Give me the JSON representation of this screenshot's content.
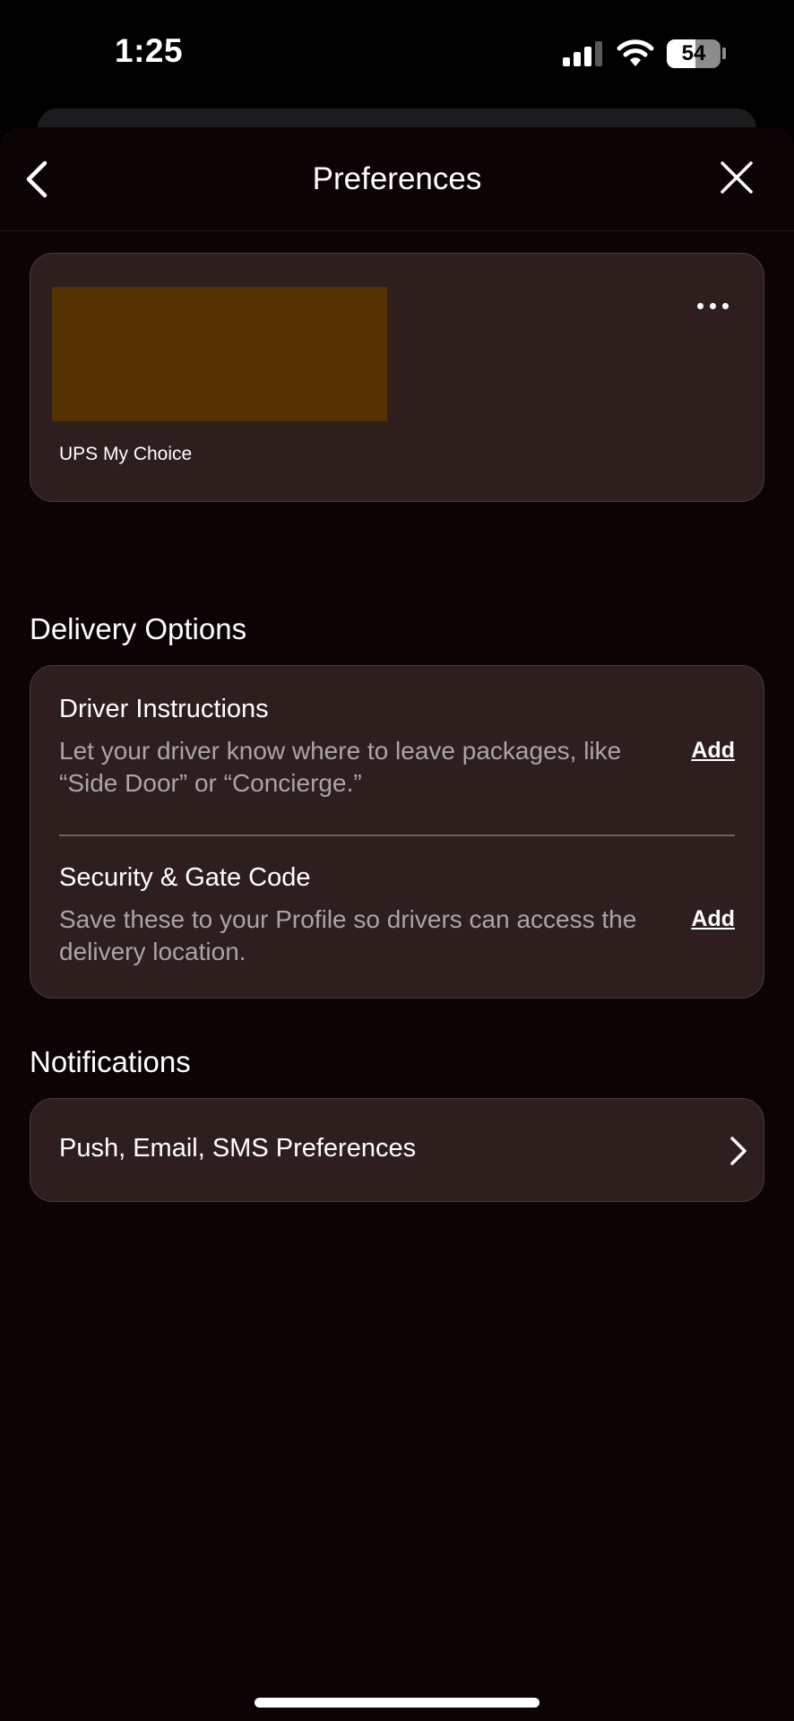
{
  "status_bar": {
    "time": "1:25",
    "battery": "54",
    "icons": [
      "cellular-signal-icon",
      "wifi-icon",
      "battery-icon"
    ]
  },
  "header": {
    "title": "Preferences",
    "back_icon": "chevron-left-icon",
    "close_icon": "close-icon"
  },
  "membership_card": {
    "label": "UPS My Choice",
    "more_icon": "more-horizontal-icon",
    "logo_color": "#553201"
  },
  "delivery_options": {
    "title": "Delivery Options",
    "items": [
      {
        "name": "Driver Instructions",
        "description": "Let your driver know where to leave packages, like “Side Door” or “Concierge.”",
        "action": "Add"
      },
      {
        "name": "Security & Gate Code",
        "description": "Save these to your Profile so drivers can access the delivery location.",
        "action": "Add"
      }
    ]
  },
  "notifications": {
    "title": "Notifications",
    "row_label": "Push, Email, SMS Preferences",
    "row_icon": "chevron-right-icon"
  },
  "colors": {
    "background": "#0c0304",
    "card": "#2e1e1d",
    "card_border": "#4b3a39",
    "secondary_text": "#aba5a5"
  }
}
